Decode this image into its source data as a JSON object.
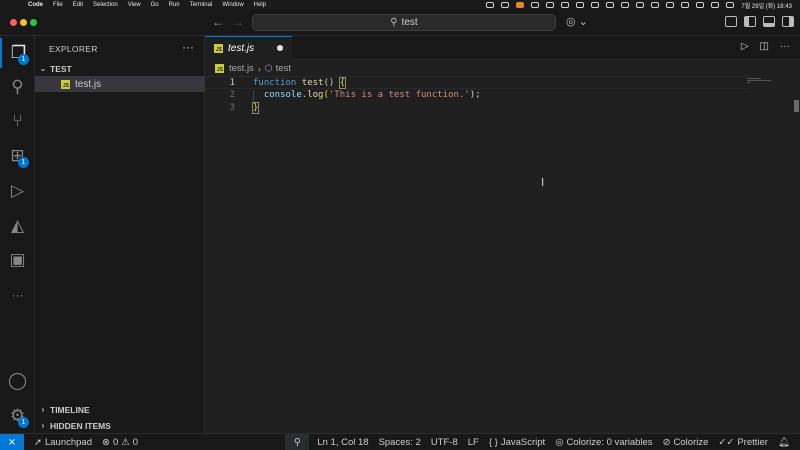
{
  "menubar": {
    "app_name": "Code",
    "items": [
      "File",
      "Edit",
      "Selection",
      "View",
      "Go",
      "Run",
      "Terminal",
      "Window",
      "Help"
    ],
    "datetime": "7월 29일 (화) 18:43"
  },
  "titlebar": {
    "search_text": "test"
  },
  "activity_bar": {
    "explorer_badge": "1",
    "extensions_badge": "1",
    "accounts_badge": "1",
    "more": "···"
  },
  "sidebar": {
    "title": "EXPLORER",
    "more": "···",
    "folder_name": "TEST",
    "files": [
      {
        "name": "test.js",
        "icon_label": "JS"
      }
    ],
    "timeline_label": "TIMELINE",
    "hidden_items_label": "HIDDEN ITEMS"
  },
  "editor": {
    "tab_label": "test.js",
    "tab_icon_label": "JS",
    "breadcrumb_file": "test.js",
    "breadcrumb_symbol": "test",
    "line_numbers": [
      "1",
      "2",
      "3"
    ],
    "code": {
      "l1_kw": "function",
      "l1_fn": "test",
      "l1_parens": "() ",
      "l1_brace": "{",
      "l2_obj": "console",
      "l2_dot": ".",
      "l2_method": "log",
      "l2_open": "(",
      "l2_str": "'This is a test function.'",
      "l2_close": ");",
      "l3_brace": "}"
    }
  },
  "statusbar": {
    "launchpad": "Launchpad",
    "errors": "0",
    "warnings": "0",
    "position": "Ln 1, Col 18",
    "spaces": "Spaces: 2",
    "encoding": "UTF-8",
    "eol": "LF",
    "language": "JavaScript",
    "colorize_vars": "Colorize: 0 variables",
    "colorize": "Colorize",
    "prettier": "Prettier"
  },
  "colors": {
    "accent": "#0078d4",
    "background": "#1f1f1f",
    "sidebar": "#181818",
    "js_icon": "#cbcb41"
  }
}
